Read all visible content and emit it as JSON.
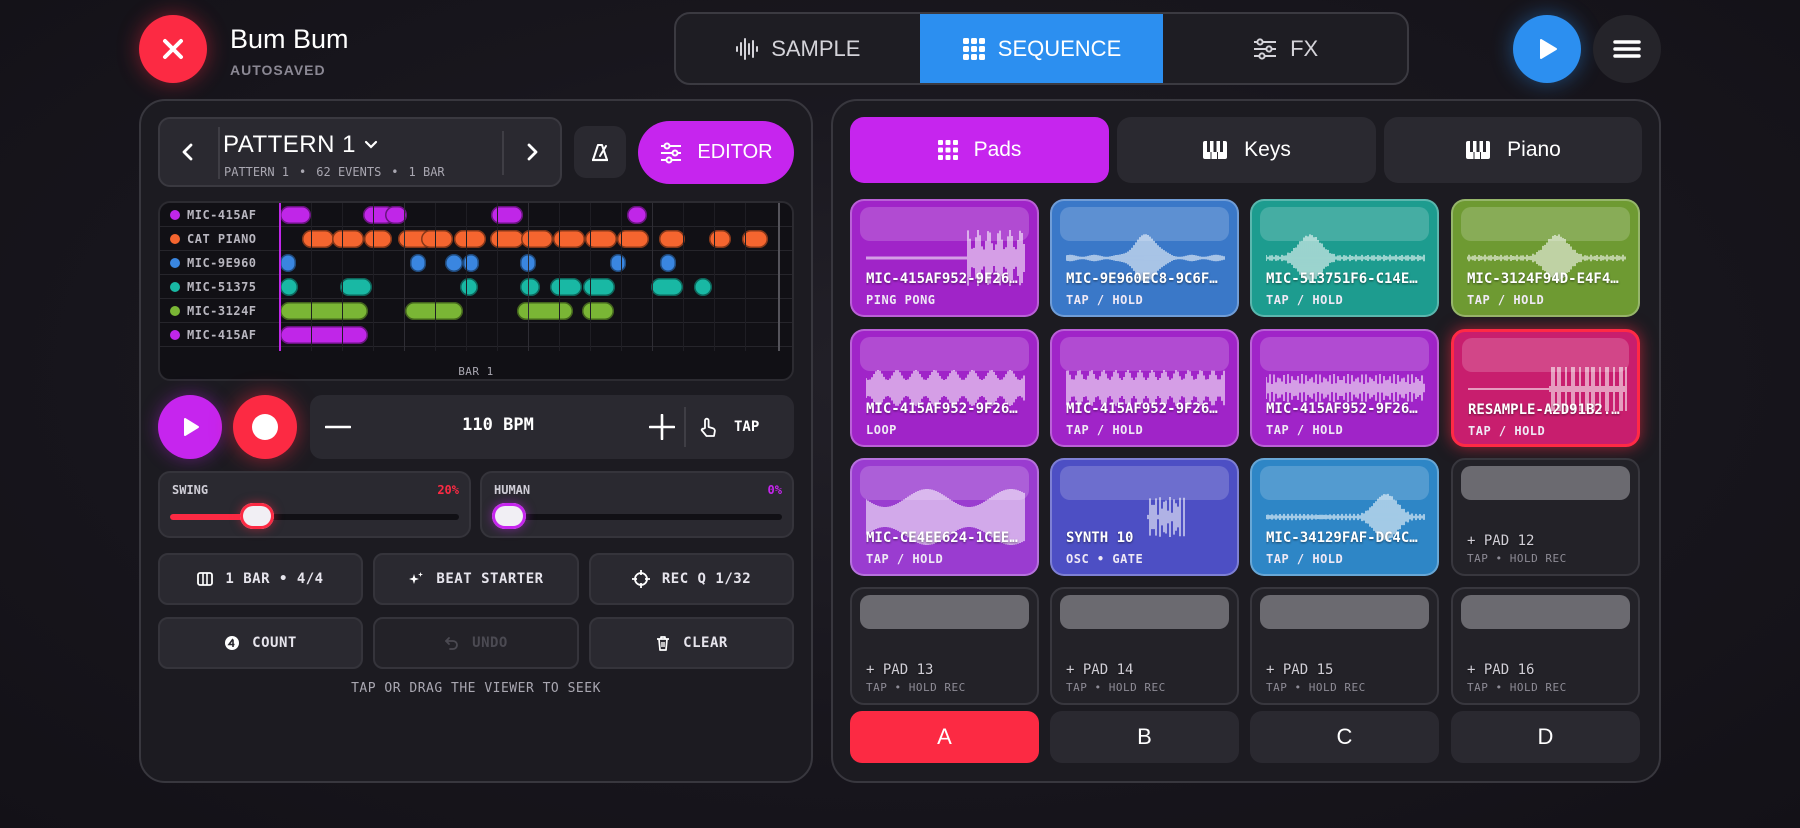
{
  "header": {
    "title": "Bum Bum",
    "subtitle": "AUTOSAVED",
    "modes": [
      {
        "label": "SAMPLE",
        "icon": "waveform-icon"
      },
      {
        "label": "SEQUENCE",
        "icon": "grid-icon"
      },
      {
        "label": "FX",
        "icon": "sliders-icon"
      }
    ],
    "active_mode": "SEQUENCE",
    "accent": "#2c8ff0",
    "close_color": "#fc2a43"
  },
  "pattern": {
    "name": "PATTERN 1",
    "meta_name": "PATTERN 1",
    "events": "62 EVENTS",
    "bars": "1 BAR",
    "editor_label": "EDITOR",
    "editor_color": "#c625ee"
  },
  "sequencer": {
    "bar_label": "BAR 1",
    "lanes": [
      {
        "name": "MIC-415AF",
        "color": "#c026e8"
      },
      {
        "name": "CAT PIANO",
        "color": "#f5652f"
      },
      {
        "name": "MIC-9E960",
        "color": "#3a86e0"
      },
      {
        "name": "MIC-51375",
        "color": "#19b8a4"
      },
      {
        "name": "MIC-3124F",
        "color": "#7ab635"
      },
      {
        "name": "MIC-415AF",
        "color": "#c026e8"
      }
    ]
  },
  "transport": {
    "bpm": "110 BPM",
    "tap_label": "TAP"
  },
  "swing": {
    "label": "SWING",
    "value": "20%",
    "level": 0.3,
    "color": "#fc2a43"
  },
  "human": {
    "label": "HUMAN",
    "value": "0%",
    "level": 0,
    "color": "#c625ee"
  },
  "buttons": {
    "bar_sig": "1 BAR • 4/4",
    "beat_starter": "BEAT STARTER",
    "rec_q": "REC Q 1/32",
    "count": "COUNT",
    "undo": "UNDO",
    "clear": "CLEAR"
  },
  "hint": "TAP OR DRAG THE VIEWER TO SEEK",
  "tabs": [
    {
      "label": "Pads",
      "active": true
    },
    {
      "label": "Keys",
      "active": false
    },
    {
      "label": "Piano",
      "active": false
    }
  ],
  "pads": [
    {
      "name": "MIC-415AF952-9F26...",
      "mode": "PING PONG",
      "color": "#a024c8"
    },
    {
      "name": "MIC-9E960EC8-9C6F...",
      "mode": "TAP / HOLD",
      "color": "#3a78c8"
    },
    {
      "name": "MIC-513751F6-C14E...",
      "mode": "TAP / HOLD",
      "color": "#1d9c8f"
    },
    {
      "name": "MIC-3124F94D-E4F4...",
      "mode": "TAP / HOLD",
      "color": "#6e9a32"
    },
    {
      "name": "MIC-415AF952-9F26...",
      "mode": "LOOP",
      "color": "#a024c8"
    },
    {
      "name": "MIC-415AF952-9F26...",
      "mode": "TAP / HOLD",
      "color": "#a024c8"
    },
    {
      "name": "MIC-415AF952-9F26...",
      "mode": "TAP / HOLD",
      "color": "#a024c8"
    },
    {
      "name": "RESAMPLE-A2D91B2...",
      "mode": "TAP / HOLD",
      "color": "#c81e6e"
    },
    {
      "name": "MIC-CE4EE624-1CEE...",
      "mode": "TAP / HOLD",
      "color": "#9a3cd0"
    },
    {
      "name": "SYNTH 10",
      "mode": "OSC • GATE",
      "color": "#4d4fc4"
    },
    {
      "name": "MIC-34129FAF-DC4C...",
      "mode": "TAP / HOLD",
      "color": "#2e86c6"
    },
    {
      "name": "+ PAD 12",
      "mode": "TAP • HOLD REC",
      "color": "#232228"
    },
    {
      "name": "+ PAD 13",
      "mode": "TAP • HOLD REC",
      "color": "#232228"
    },
    {
      "name": "+ PAD 14",
      "mode": "TAP • HOLD REC",
      "color": "#232228"
    },
    {
      "name": "+ PAD 15",
      "mode": "TAP • HOLD REC",
      "color": "#232228"
    },
    {
      "name": "+ PAD 16",
      "mode": "TAP • HOLD REC",
      "color": "#232228"
    }
  ],
  "banks": [
    {
      "label": "A",
      "active": true
    },
    {
      "label": "B",
      "active": false
    },
    {
      "label": "C",
      "active": false
    },
    {
      "label": "D",
      "active": false
    }
  ]
}
